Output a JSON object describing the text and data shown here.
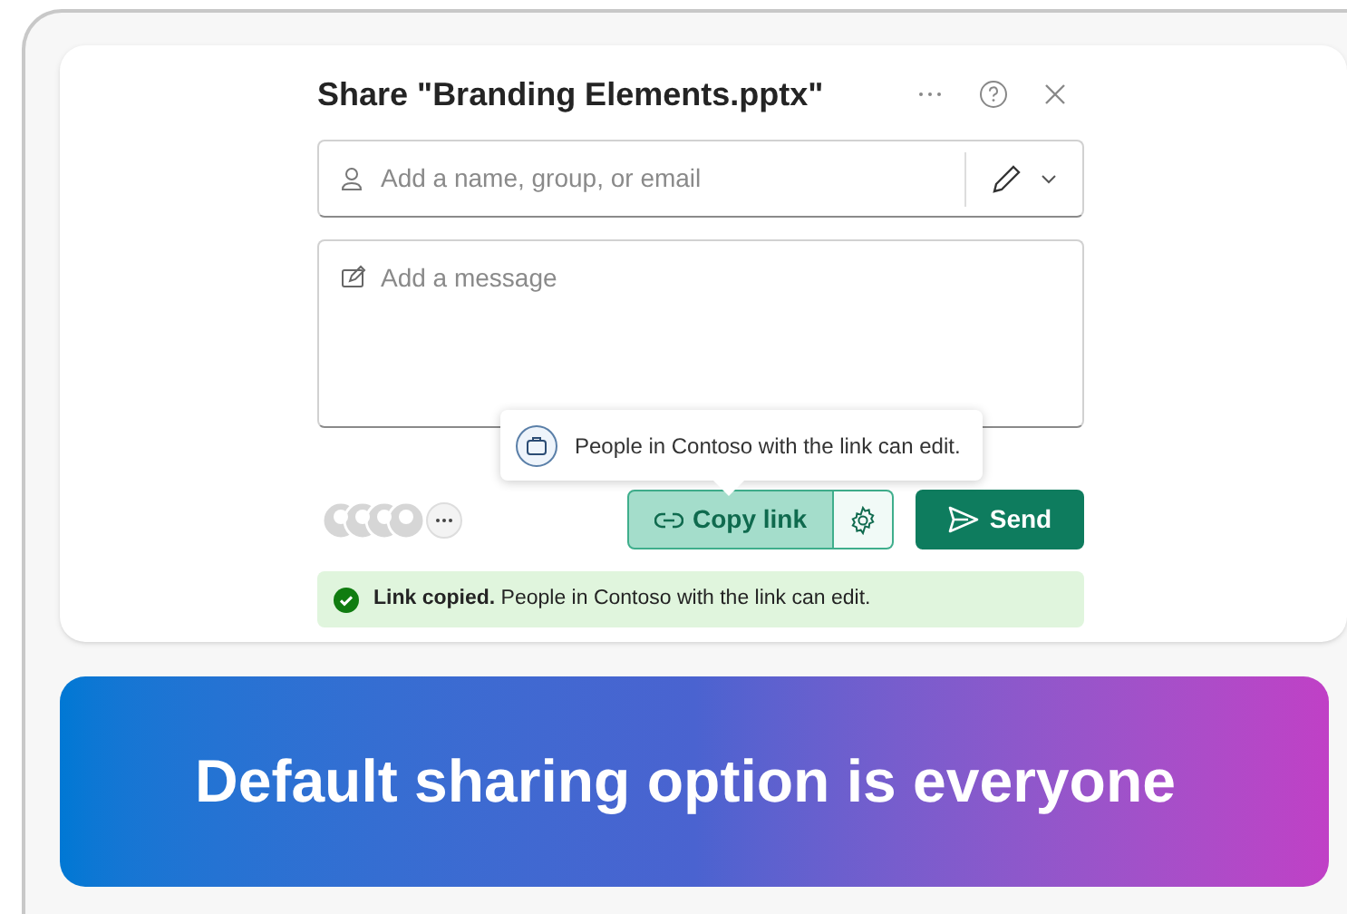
{
  "dialog": {
    "title": "Share \"Branding Elements.pptx\"",
    "recipients": {
      "placeholder": "Add a name, group, or email"
    },
    "message": {
      "placeholder": "Add a message"
    },
    "tooltip": "People in Contoso with the link can edit.",
    "copy_link": "Copy link",
    "send": "Send",
    "banner": "**Link copied.** People in Contoso with the link can edit."
  },
  "caption": "Default sharing option is everyone"
}
